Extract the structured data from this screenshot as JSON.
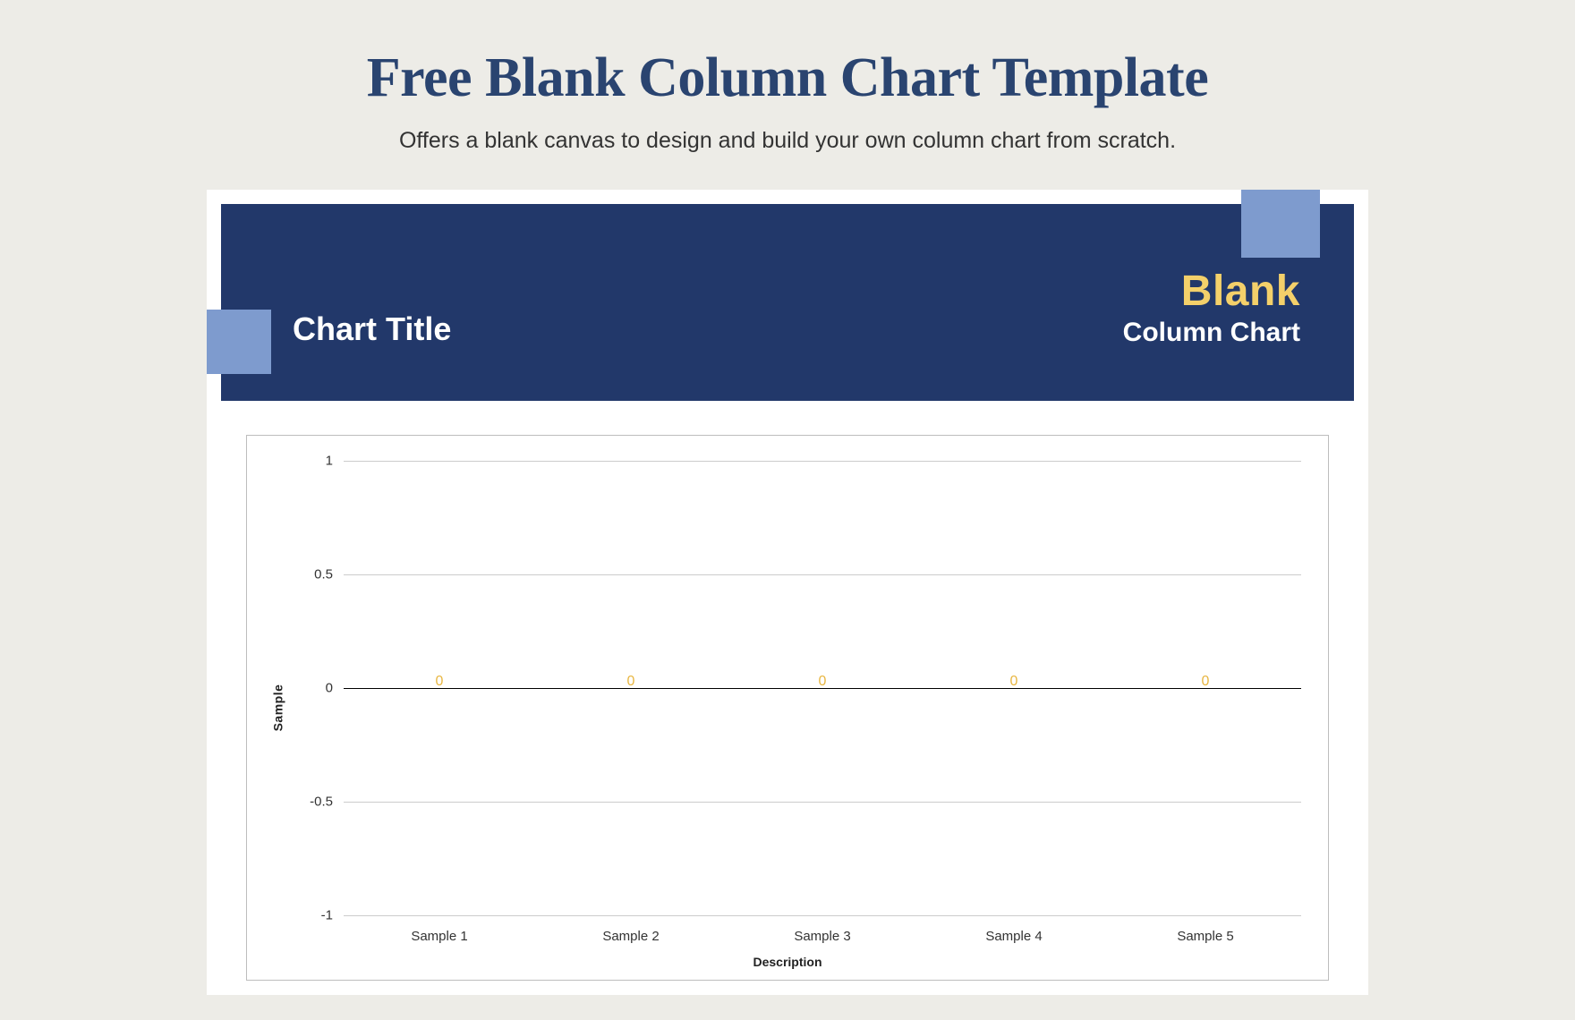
{
  "page": {
    "title": "Free Blank Column Chart Template",
    "subtitle": "Offers a blank canvas to design and build your own column chart from scratch."
  },
  "banner": {
    "chart_title": "Chart Title",
    "tag_top": "Blank",
    "tag_bottom": "Column Chart"
  },
  "chart_data": {
    "type": "bar",
    "title": "",
    "xlabel": "Description",
    "ylabel": "Sample",
    "ylim": [
      -1,
      1
    ],
    "yticks": [
      -1,
      -0.5,
      0,
      0.5,
      1
    ],
    "categories": [
      "Sample 1",
      "Sample 2",
      "Sample 3",
      "Sample 4",
      "Sample 5"
    ],
    "values": [
      0,
      0,
      0,
      0,
      0
    ]
  }
}
